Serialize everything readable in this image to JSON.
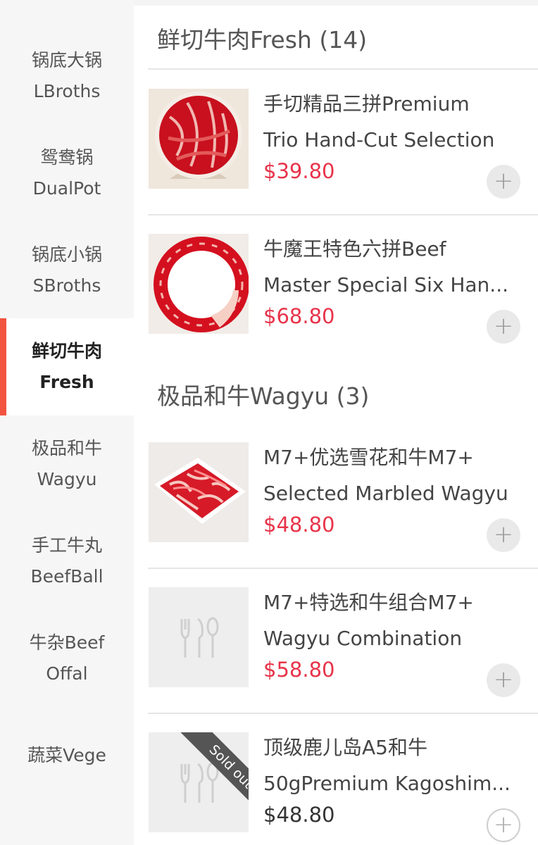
{
  "sidebar": {
    "categories": [
      {
        "line1": "锅底大锅",
        "line2": "LBroths"
      },
      {
        "line1": "鸳鸯锅",
        "line2": "DualPot"
      },
      {
        "line1": "锅底小锅",
        "line2": "SBroths"
      },
      {
        "line1": "鲜切牛肉",
        "line2": "Fresh"
      },
      {
        "line1": "极品和牛",
        "line2": "Wagyu"
      },
      {
        "line1": "手工牛丸",
        "line2": "BeefBall"
      },
      {
        "line1": "牛杂Beef",
        "line2": "Offal"
      },
      {
        "line1": "蔬菜Vege"
      }
    ],
    "active_index": 3
  },
  "sections": [
    {
      "title": "鲜切牛肉Fresh (14)",
      "items": [
        {
          "name_line1": "手切精品三拼Premium",
          "name_line2": "Trio Hand-Cut Selection",
          "price": "$39.80",
          "image": "beef-platter-round"
        },
        {
          "name_line1": "牛魔王特色六拼Beef",
          "name_line2": "Master Special Six Han...",
          "price": "$68.80",
          "image": "beef-platter-ring"
        }
      ]
    },
    {
      "title": "极品和牛Wagyu (3)",
      "items": [
        {
          "name_line1": "M7+优选雪花和牛M7+",
          "name_line2": "Selected Marbled Wagyu",
          "price": "$48.80",
          "image": "wagyu-tray"
        },
        {
          "name_line1": "M7+特选和牛组合M7+",
          "name_line2": "Wagyu Combination",
          "price": "$58.80",
          "image": "utensils-placeholder-icon"
        },
        {
          "name_line1": "顶级鹿儿岛A5和牛",
          "name_line2": "50gPremium Kagoshim...",
          "price": "$48.80",
          "image": "utensils-placeholder-icon",
          "badge": "Sold out"
        }
      ]
    }
  ],
  "icons": {
    "add": "+"
  },
  "colors": {
    "accent": "#f3543f",
    "price": "#e8334a",
    "sold_price": "#333333"
  }
}
